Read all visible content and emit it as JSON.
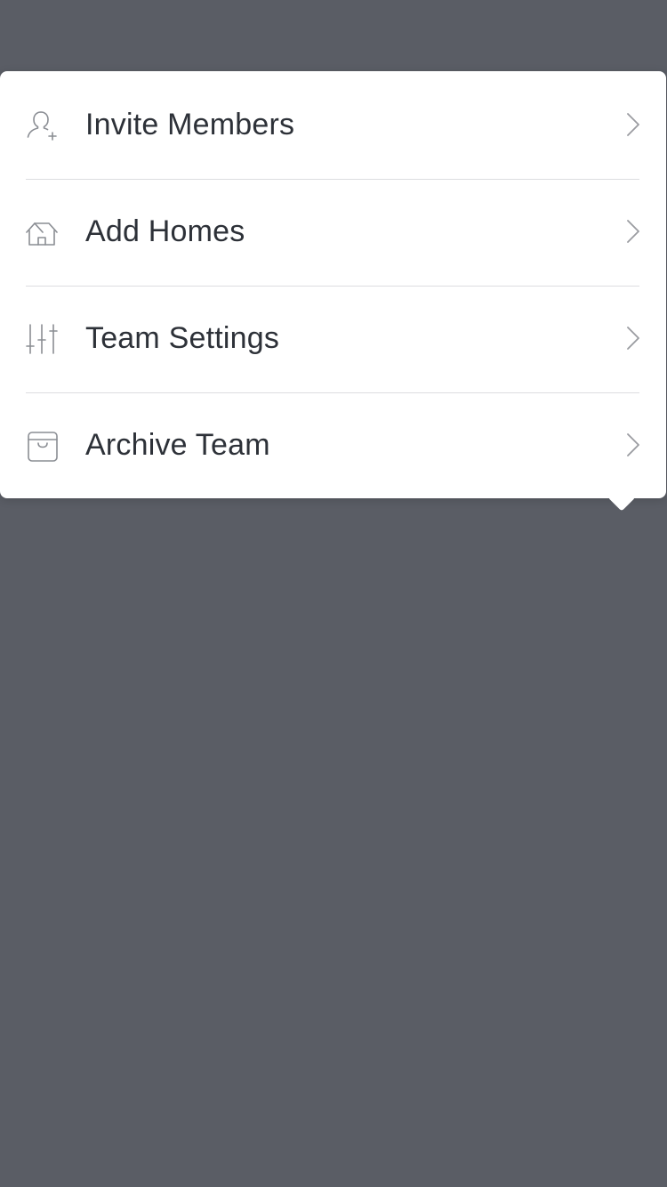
{
  "menu": {
    "items": [
      {
        "label": "Invite Members",
        "icon": "add-user-icon"
      },
      {
        "label": "Add Homes",
        "icon": "home-icon"
      },
      {
        "label": "Team Settings",
        "icon": "sliders-icon"
      },
      {
        "label": "Archive Team",
        "icon": "archive-box-icon"
      }
    ]
  },
  "colors": {
    "backdrop": "#5a5d65",
    "panel": "#ffffff",
    "text": "#2d3138",
    "icon": "#8a8d93",
    "divider": "#dcdde0"
  }
}
